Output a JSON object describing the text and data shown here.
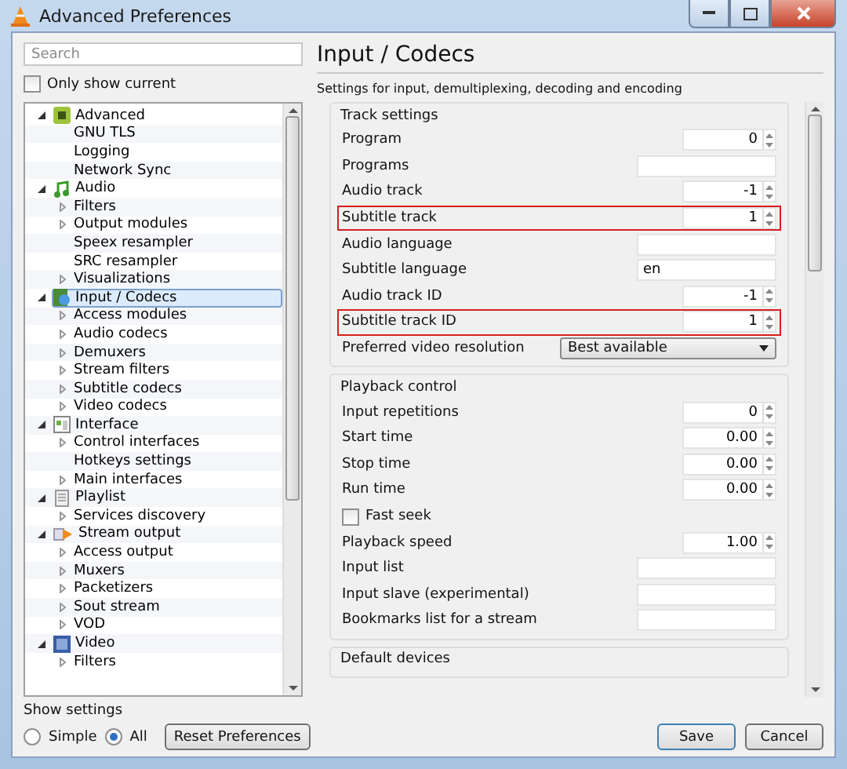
{
  "window": {
    "title": "Advanced Preferences"
  },
  "search": {
    "placeholder": "Search"
  },
  "only_show_current": {
    "label": "Only show current",
    "checked": false
  },
  "tree": [
    {
      "label": "Advanced",
      "kind": "advanced",
      "expanded": true,
      "selected": false,
      "children": [
        {
          "label": "GNU TLS",
          "expandable": false,
          "selected": false
        },
        {
          "label": "Logging",
          "expandable": false,
          "selected": false
        },
        {
          "label": "Network Sync",
          "expandable": false,
          "selected": false
        }
      ]
    },
    {
      "label": "Audio",
      "kind": "audio",
      "expanded": true,
      "selected": false,
      "children": [
        {
          "label": "Filters",
          "expandable": true,
          "selected": false
        },
        {
          "label": "Output modules",
          "expandable": true,
          "selected": false
        },
        {
          "label": "Speex resampler",
          "expandable": false,
          "selected": false
        },
        {
          "label": "SRC resampler",
          "expandable": false,
          "selected": false
        },
        {
          "label": "Visualizations",
          "expandable": true,
          "selected": false
        }
      ]
    },
    {
      "label": "Input / Codecs",
      "kind": "input",
      "expanded": true,
      "selected": true,
      "children": [
        {
          "label": "Access modules",
          "expandable": true,
          "selected": false
        },
        {
          "label": "Audio codecs",
          "expandable": true,
          "selected": false
        },
        {
          "label": "Demuxers",
          "expandable": true,
          "selected": false
        },
        {
          "label": "Stream filters",
          "expandable": true,
          "selected": false
        },
        {
          "label": "Subtitle codecs",
          "expandable": true,
          "selected": false
        },
        {
          "label": "Video codecs",
          "expandable": true,
          "selected": false
        }
      ]
    },
    {
      "label": "Interface",
      "kind": "interface",
      "expanded": true,
      "selected": false,
      "children": [
        {
          "label": "Control interfaces",
          "expandable": true,
          "selected": false
        },
        {
          "label": "Hotkeys settings",
          "expandable": false,
          "selected": false
        },
        {
          "label": "Main interfaces",
          "expandable": true,
          "selected": false
        }
      ]
    },
    {
      "label": "Playlist",
      "kind": "playlist",
      "expanded": true,
      "selected": false,
      "children": [
        {
          "label": "Services discovery",
          "expandable": true,
          "selected": false
        }
      ]
    },
    {
      "label": "Stream output",
      "kind": "stream",
      "expanded": true,
      "selected": false,
      "children": [
        {
          "label": "Access output",
          "expandable": true,
          "selected": false
        },
        {
          "label": "Muxers",
          "expandable": true,
          "selected": false
        },
        {
          "label": "Packetizers",
          "expandable": true,
          "selected": false
        },
        {
          "label": "Sout stream",
          "expandable": true,
          "selected": false
        },
        {
          "label": "VOD",
          "expandable": true,
          "selected": false
        }
      ]
    },
    {
      "label": "Video",
      "kind": "video",
      "expanded": true,
      "selected": false,
      "children": [
        {
          "label": "Filters",
          "expandable": true,
          "selected": false
        }
      ]
    }
  ],
  "show_settings": {
    "label": "Show settings",
    "options": [
      {
        "label": "Simple",
        "selected": false
      },
      {
        "label": "All",
        "selected": true
      }
    ]
  },
  "reset_button": "Reset Preferences",
  "panel": {
    "title": "Input / Codecs",
    "subtitle": "Settings for input, demultiplexing, decoding and encoding",
    "groups": [
      {
        "title": "Track settings",
        "rows": [
          {
            "kind": "spin",
            "label": "Program",
            "value": "0",
            "highlighted": false
          },
          {
            "kind": "text",
            "label": "Programs",
            "value": "",
            "highlighted": false
          },
          {
            "kind": "spin",
            "label": "Audio track",
            "value": "-1",
            "highlighted": false
          },
          {
            "kind": "spin",
            "label": "Subtitle track",
            "value": "1",
            "highlighted": true
          },
          {
            "kind": "text",
            "label": "Audio language",
            "value": "",
            "highlighted": false
          },
          {
            "kind": "text",
            "label": "Subtitle language",
            "value": "en",
            "highlighted": false
          },
          {
            "kind": "spin",
            "label": "Audio track ID",
            "value": "-1",
            "highlighted": false
          },
          {
            "kind": "spin",
            "label": "Subtitle track ID",
            "value": "1",
            "highlighted": true
          },
          {
            "kind": "combo",
            "label": "Preferred video resolution",
            "value": "Best available",
            "highlighted": false
          }
        ]
      },
      {
        "title": "Playback control",
        "rows": [
          {
            "kind": "spin",
            "label": "Input repetitions",
            "value": "0",
            "highlighted": false
          },
          {
            "kind": "spin",
            "label": "Start time",
            "value": "0.00",
            "highlighted": false
          },
          {
            "kind": "spin",
            "label": "Stop time",
            "value": "0.00",
            "highlighted": false
          },
          {
            "kind": "spin",
            "label": "Run time",
            "value": "0.00",
            "highlighted": false
          },
          {
            "kind": "checkbox",
            "label": "Fast seek",
            "checked": false,
            "highlighted": false
          },
          {
            "kind": "spin",
            "label": "Playback speed",
            "value": "1.00",
            "highlighted": false
          },
          {
            "kind": "text",
            "label": "Input list",
            "value": "",
            "highlighted": false
          },
          {
            "kind": "text",
            "label": "Input slave (experimental)",
            "value": "",
            "highlighted": false
          },
          {
            "kind": "text",
            "label": "Bookmarks list for a stream",
            "value": "",
            "highlighted": false
          }
        ]
      },
      {
        "title": "Default devices"
      }
    ]
  },
  "buttons": [
    {
      "label": "Save",
      "default": true
    },
    {
      "label": "Cancel",
      "default": false
    }
  ]
}
